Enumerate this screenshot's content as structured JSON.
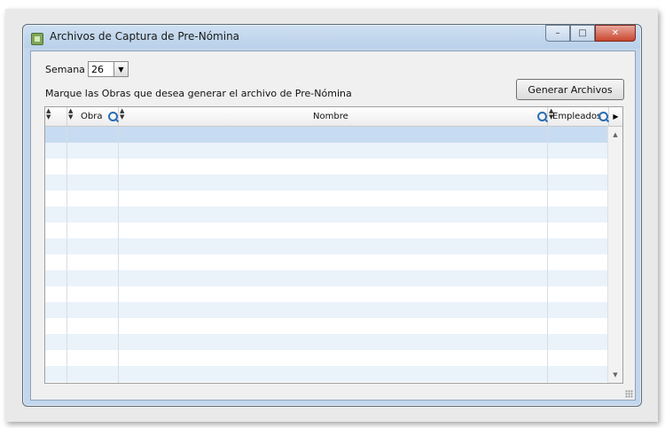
{
  "window": {
    "title": "Archivos de Captura de Pre-Nómina"
  },
  "caption": {
    "minimize": "–",
    "maximize": "□",
    "close": "✕"
  },
  "form": {
    "semana_label": "Semana",
    "semana_value": "26",
    "instruction": "Marque las Obras que desea generar el archivo de Pre-Nómina",
    "generate_button": "Generar Archivos"
  },
  "grid": {
    "columns": [
      "",
      "Obra",
      "Nombre",
      "Empleados"
    ],
    "row_count": 16
  },
  "icons": {
    "app": "form-icon",
    "search": "magnifier-icon",
    "dropdown": "chevron-down-icon"
  }
}
